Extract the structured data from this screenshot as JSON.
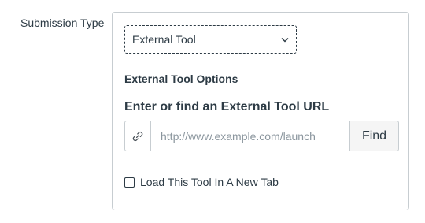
{
  "submission": {
    "label": "Submission Type",
    "selected_type": "External Tool"
  },
  "external_tool": {
    "section_title": "External Tool Options",
    "url_heading": "Enter or find an External Tool URL",
    "url_value": "",
    "url_placeholder": "http://www.example.com/launch",
    "find_label": "Find",
    "new_tab_label": "Load This Tool In A New Tab",
    "new_tab_checked": false
  },
  "icons": {
    "select_arrow": "chevron-down-icon",
    "url_addon": "link-icon"
  }
}
